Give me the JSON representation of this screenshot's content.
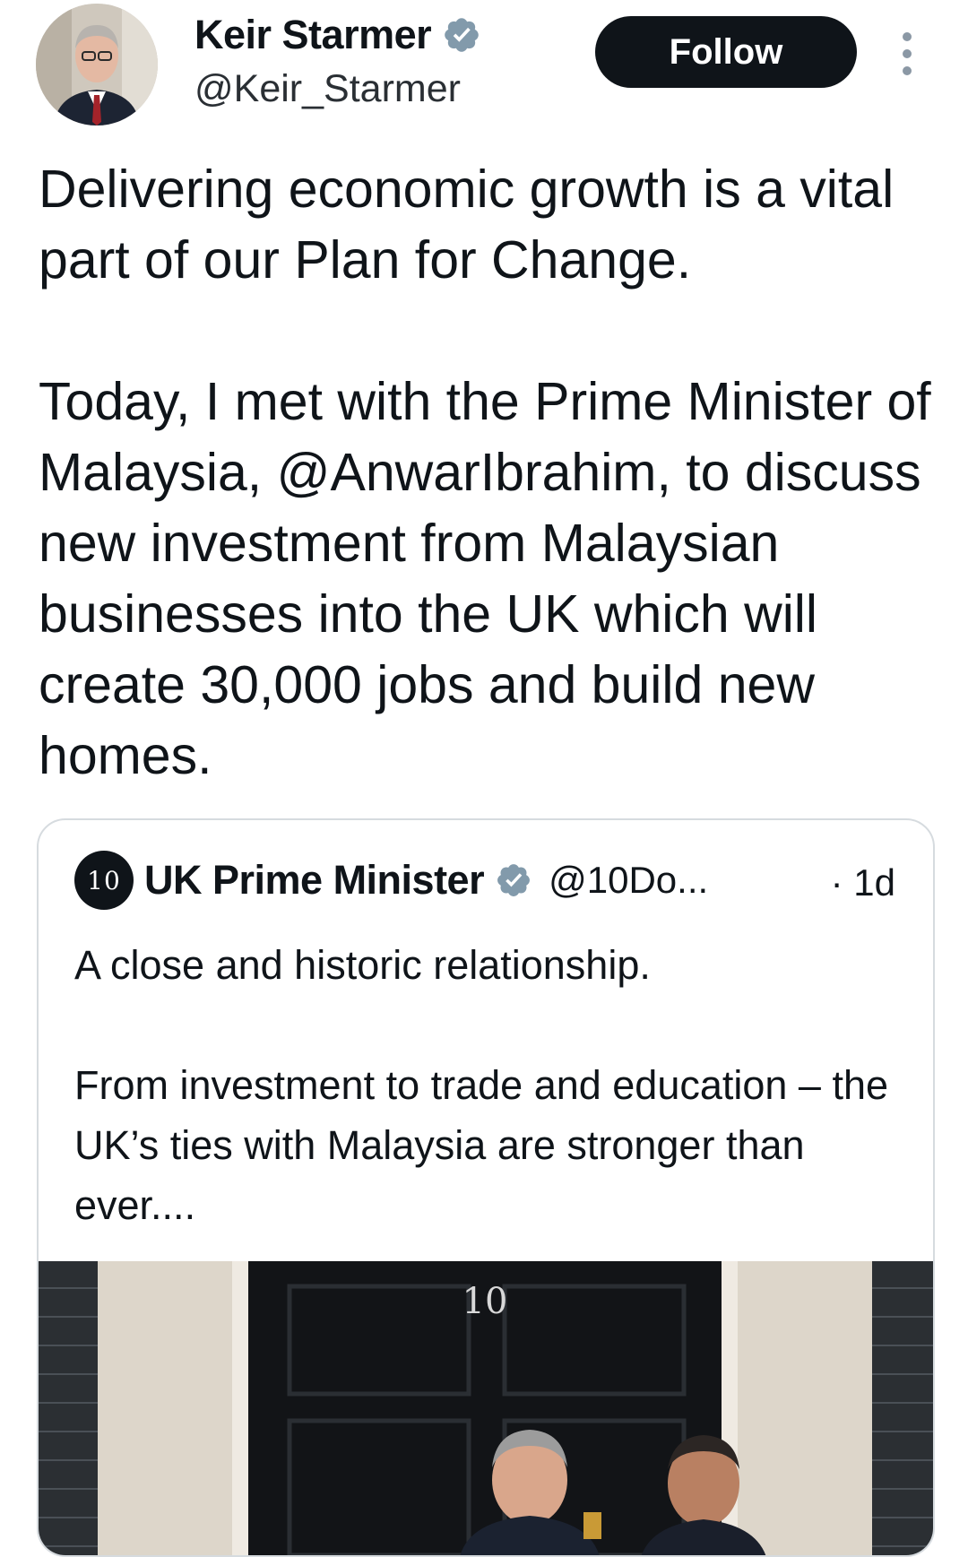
{
  "author": {
    "display_name": "Keir Starmer",
    "handle": "@Keir_Starmer",
    "avatar_icon": "profile-photo",
    "verified_icon": "verified-badge-icon",
    "verified_color": "#829aab"
  },
  "actions": {
    "follow_label": "Follow",
    "more_icon": "more-vertical-icon"
  },
  "tweet": {
    "paragraphs": [
      "Delivering economic growth is a vital part of our Plan for Change.",
      "Today, I met with the Prime Minister of Malaysia, @AnwarIbrahim, to discuss new investment from Malaysian businesses into the UK which will create 30,000 jobs and build new homes."
    ]
  },
  "quoted_tweet": {
    "avatar_text": "10",
    "display_name": "UK Prime Minister",
    "handle": "@10Do...",
    "time": "· 1d",
    "paragraphs": [
      "A close and historic relationship.",
      "From investment to trade and education – the UK’s ties with Malaysia are stronger than ever...."
    ],
    "image": {
      "door_number": "10"
    }
  },
  "colors": {
    "text": "#0f1419",
    "follow_bg": "#0f1419",
    "border": "#d6dbdf"
  }
}
